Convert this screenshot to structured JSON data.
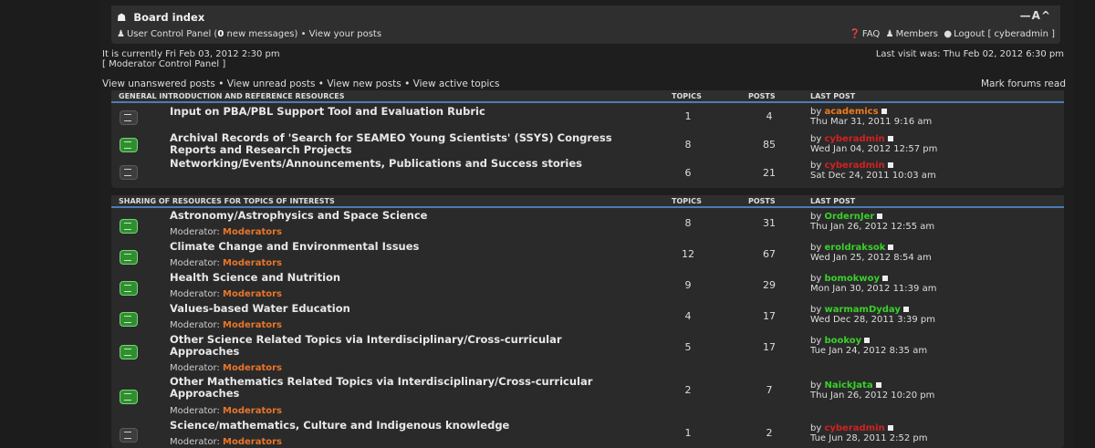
{
  "nav": {
    "board_index": "Board index",
    "resize": "—A^",
    "ucp_prefix": "User Control Panel (",
    "ucp_count": "0",
    "ucp_suffix": " new messages)",
    "sep": " • ",
    "view_posts": "View your posts",
    "faq": "FAQ",
    "members": "Members",
    "logout": "Logout [ cyberadmin ]"
  },
  "info": {
    "current_time": "It is currently Fri Feb 03, 2012 2:30 pm",
    "mcp": "[ Moderator Control Panel ]",
    "last_visit": "Last visit was: Thu Feb 02, 2012 6:30 pm"
  },
  "quicklinks": {
    "unanswered": "View unanswered posts",
    "unread": "View unread posts",
    "new": "View new posts",
    "active": "View active topics",
    "mark_read": "Mark forums read"
  },
  "sections": [
    {
      "title": "GENERAL INTRODUCTION AND REFERENCE RESOURCES",
      "col_topics": "TOPICS",
      "col_posts": "POSTS",
      "col_last": "LAST POST",
      "forums": [
        {
          "title": "Input on PBA/PBL Support Tool and Evaluation Rubric",
          "topics": "1",
          "posts": "4",
          "by": "by",
          "user": "academics",
          "date": "Thu Mar 31, 2011 9:16 am"
        },
        {
          "title": "Archival Records of 'Search for SEAMEO Young Scientists' (SSYS) Congress Reports and Research Projects",
          "topics": "8",
          "posts": "85",
          "by": "by",
          "user": "cyberadmin",
          "date": "Wed Jan 04, 2012 12:57 pm"
        },
        {
          "title": "Networking/Events/Announcements, Publications and Success stories",
          "topics": "6",
          "posts": "21",
          "by": "by",
          "user": "cyberadmin",
          "date": "Sat Dec 24, 2011 10:03 am"
        }
      ]
    },
    {
      "title": "SHARING OF RESOURCES FOR TOPICS OF INTERESTS",
      "col_topics": "TOPICS",
      "col_posts": "POSTS",
      "col_last": "LAST POST",
      "moderator_label": "Moderator:",
      "moderator_link": "Moderators",
      "forums": [
        {
          "title": "Astronomy/Astrophysics and Space Science",
          "topics": "8",
          "posts": "31",
          "by": "by",
          "user": "OrdernJer",
          "date": "Thu Jan 26, 2012 12:55 am"
        },
        {
          "title": "Climate Change and Environmental Issues",
          "topics": "12",
          "posts": "67",
          "by": "by",
          "user": "eroldraksok",
          "date": "Wed Jan 25, 2012 8:54 am"
        },
        {
          "title": "Health Science and Nutrition",
          "topics": "9",
          "posts": "29",
          "by": "by",
          "user": "bomokwoy",
          "date": "Mon Jan 30, 2012 11:39 am"
        },
        {
          "title": "Values-based Water Education",
          "topics": "4",
          "posts": "17",
          "by": "by",
          "user": "warmamDyday",
          "date": "Wed Dec 28, 2011 3:39 pm"
        },
        {
          "title": "Other Science Related Topics via Interdisciplinary/Cross-curricular Approaches",
          "topics": "5",
          "posts": "17",
          "by": "by",
          "user": "bookoy",
          "date": "Tue Jan 24, 2012 8:35 am"
        },
        {
          "title": "Other Mathematics Related Topics via Interdisciplinary/Cross-curricular Approaches",
          "topics": "2",
          "posts": "7",
          "by": "by",
          "user": "NaickJata",
          "date": "Thu Jan 26, 2012 10:20 pm"
        },
        {
          "title": "Science/mathematics, Culture and Indigenous knowledge",
          "topics": "1",
          "posts": "2",
          "by": "by",
          "user": "cyberadmin",
          "date": "Tue Jun 28, 2011 2:52 pm"
        }
      ]
    }
  ]
}
